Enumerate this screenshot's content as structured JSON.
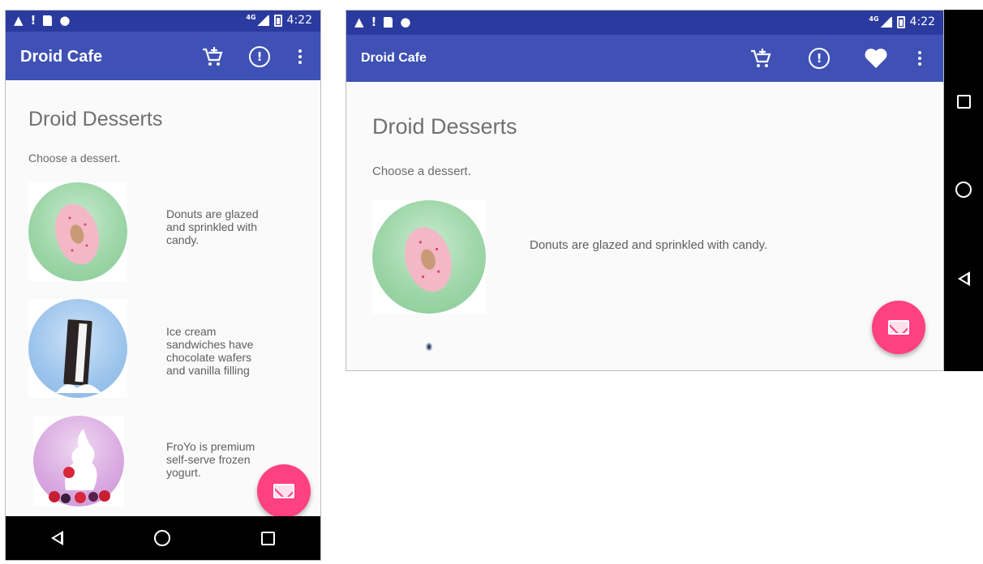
{
  "status_bar": {
    "time": "4:22",
    "network": "4G"
  },
  "app": {
    "title": "Droid Cafe"
  },
  "toolbar_icons": [
    "cart-add-icon",
    "alert-icon",
    "favorite-icon",
    "overflow-menu-icon"
  ],
  "content": {
    "title": "Droid Desserts",
    "subtitle": "Choose a dessert."
  },
  "desserts": [
    {
      "image": "donut-image",
      "description_portrait": "Donuts are glazed\nand sprinkled with\ncandy.",
      "description": "Donuts are glazed and sprinkled with candy."
    },
    {
      "image": "ice-cream-sandwich-image",
      "description_portrait": "Ice cream\nsandwiches have\nchocolate wafers\nand vanilla filling",
      "description": "Ice cream sandwiches have chocolate wafers and vanilla filling"
    },
    {
      "image": "froyo-image",
      "description_portrait": "FroYo is premium\nself-serve frozen\nyogurt.",
      "description": "FroYo is premium self-serve frozen yogurt."
    }
  ],
  "colors": {
    "primary": "#3f51b5",
    "primary_dark": "#2a3a9e",
    "accent": "#ff4081"
  },
  "navigation": [
    "back-icon",
    "home-icon",
    "recents-icon"
  ]
}
